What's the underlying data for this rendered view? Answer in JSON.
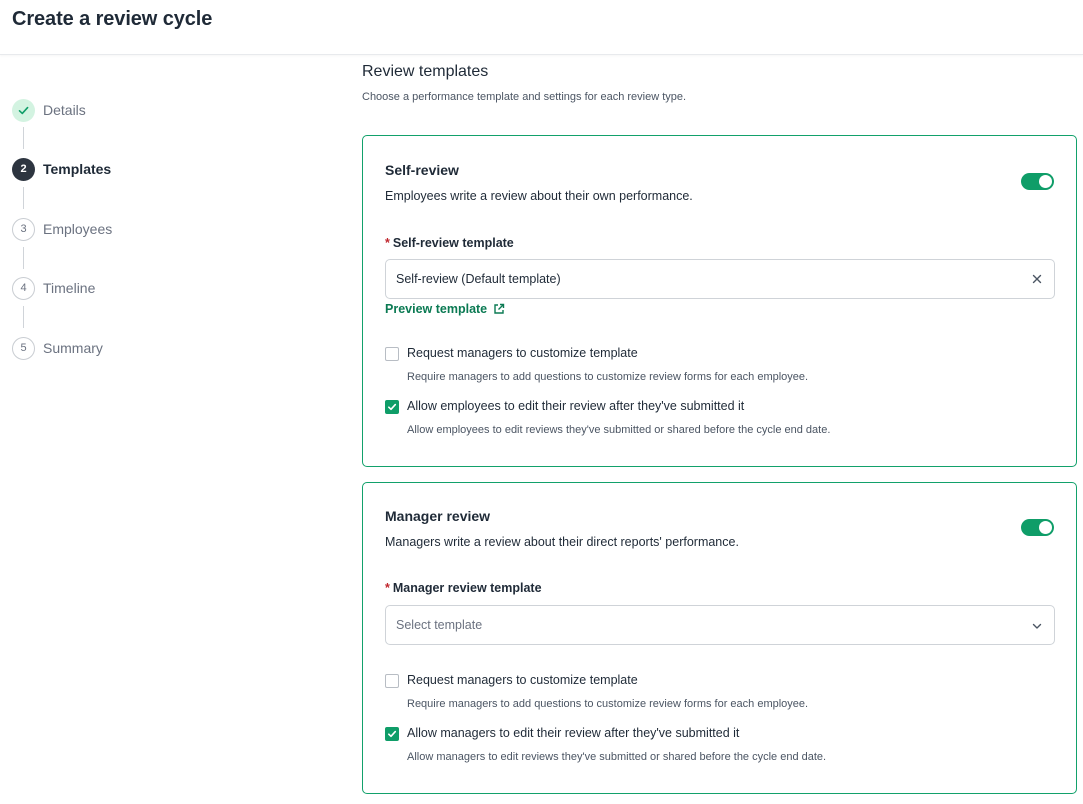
{
  "header": {
    "title": "Create a review cycle"
  },
  "stepper": {
    "steps": [
      {
        "number": "",
        "label": "Details",
        "state": "done"
      },
      {
        "number": "2",
        "label": "Templates",
        "state": "active"
      },
      {
        "number": "3",
        "label": "Employees",
        "state": "pending"
      },
      {
        "number": "4",
        "label": "Timeline",
        "state": "pending"
      },
      {
        "number": "5",
        "label": "Summary",
        "state": "pending"
      }
    ]
  },
  "main": {
    "title": "Review templates",
    "description": "Choose a performance template and settings for each review type."
  },
  "self_review": {
    "title": "Self-review",
    "description": "Employees write a review about their own performance.",
    "enabled": true,
    "template_label": "Self-review template",
    "template_value": "Self-review (Default template)",
    "preview_link": "Preview template",
    "options": [
      {
        "label": "Request managers to customize template",
        "desc": "Require managers to add questions to customize review forms for each employee.",
        "checked": false
      },
      {
        "label": "Allow employees to edit their review after they've submitted it",
        "desc": "Allow employees to edit reviews they've submitted or shared before the cycle end date.",
        "checked": true
      }
    ]
  },
  "manager_review": {
    "title": "Manager review",
    "description": "Managers write a review about their direct reports' performance.",
    "enabled": true,
    "template_label": "Manager review template",
    "template_placeholder": "Select template",
    "options": [
      {
        "label": "Request managers to customize template",
        "desc": "Require managers to add questions to customize review forms for each employee.",
        "checked": false
      },
      {
        "label": "Allow managers to edit their review after they've submitted it",
        "desc": "Allow managers to edit reviews they've submitted or shared before the cycle end date.",
        "checked": true
      }
    ]
  },
  "colors": {
    "accent": "#0f9d68",
    "link": "#0b7a53",
    "required": "#c0262d",
    "active_step": "#2d3540",
    "done_step": "#d3f3e1"
  }
}
